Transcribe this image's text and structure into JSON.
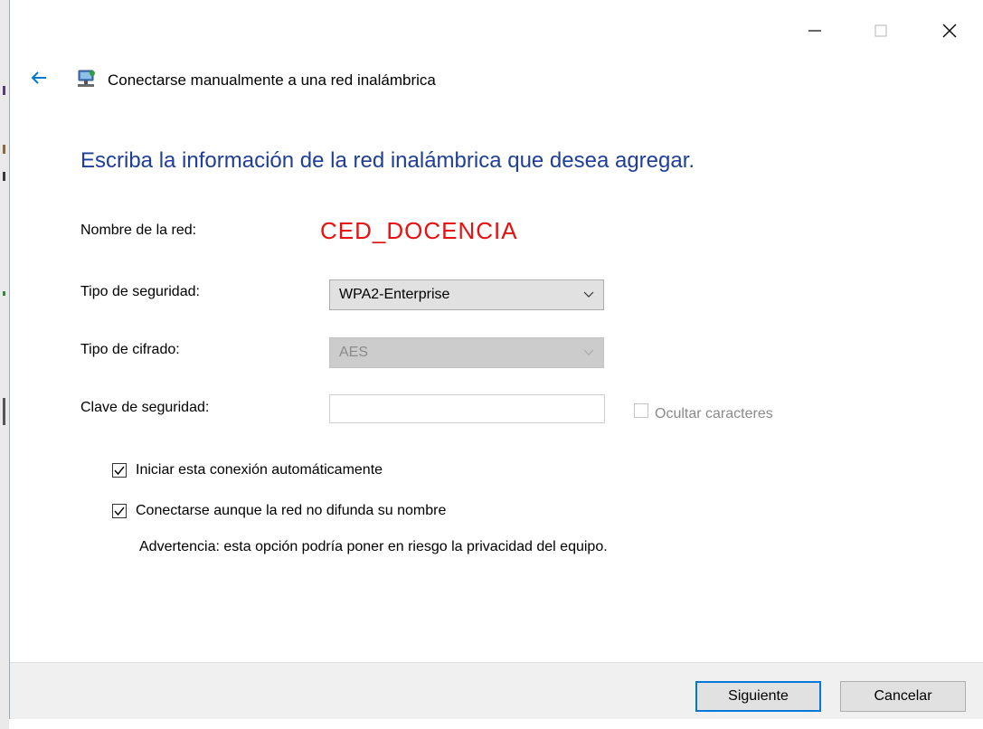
{
  "window": {
    "title": "Conectarse manualmente a una red inalámbrica",
    "minimize_icon": "minimize-icon",
    "maximize_icon": "maximize-icon",
    "close_icon": "close-icon"
  },
  "heading": "Escriba la información de la red inalámbrica que desea agregar.",
  "form": {
    "network_name_label": "Nombre de la red:",
    "network_name_value": "CED_DOCENCIA",
    "security_type_label": "Tipo de seguridad:",
    "security_type_value": "WPA2-Enterprise",
    "encryption_type_label": "Tipo de cifrado:",
    "encryption_type_value": "AES",
    "security_key_label": "Clave de seguridad:",
    "security_key_value": "",
    "hide_characters_label": "Ocultar caracteres",
    "hide_characters_checked": false,
    "auto_connect_label": "Iniciar esta conexión automáticamente",
    "auto_connect_checked": true,
    "connect_hidden_label": "Conectarse aunque la red no difunda su nombre",
    "connect_hidden_checked": true,
    "warning_text": "Advertencia: esta opción podría poner en riesgo la privacidad del equipo."
  },
  "buttons": {
    "next_label": "Siguiente",
    "cancel_label": "Cancelar"
  },
  "colors": {
    "heading": "#1e3e9a",
    "network_name": "#e81010",
    "accent": "#0078d7",
    "back_arrow": "#0078d7"
  }
}
